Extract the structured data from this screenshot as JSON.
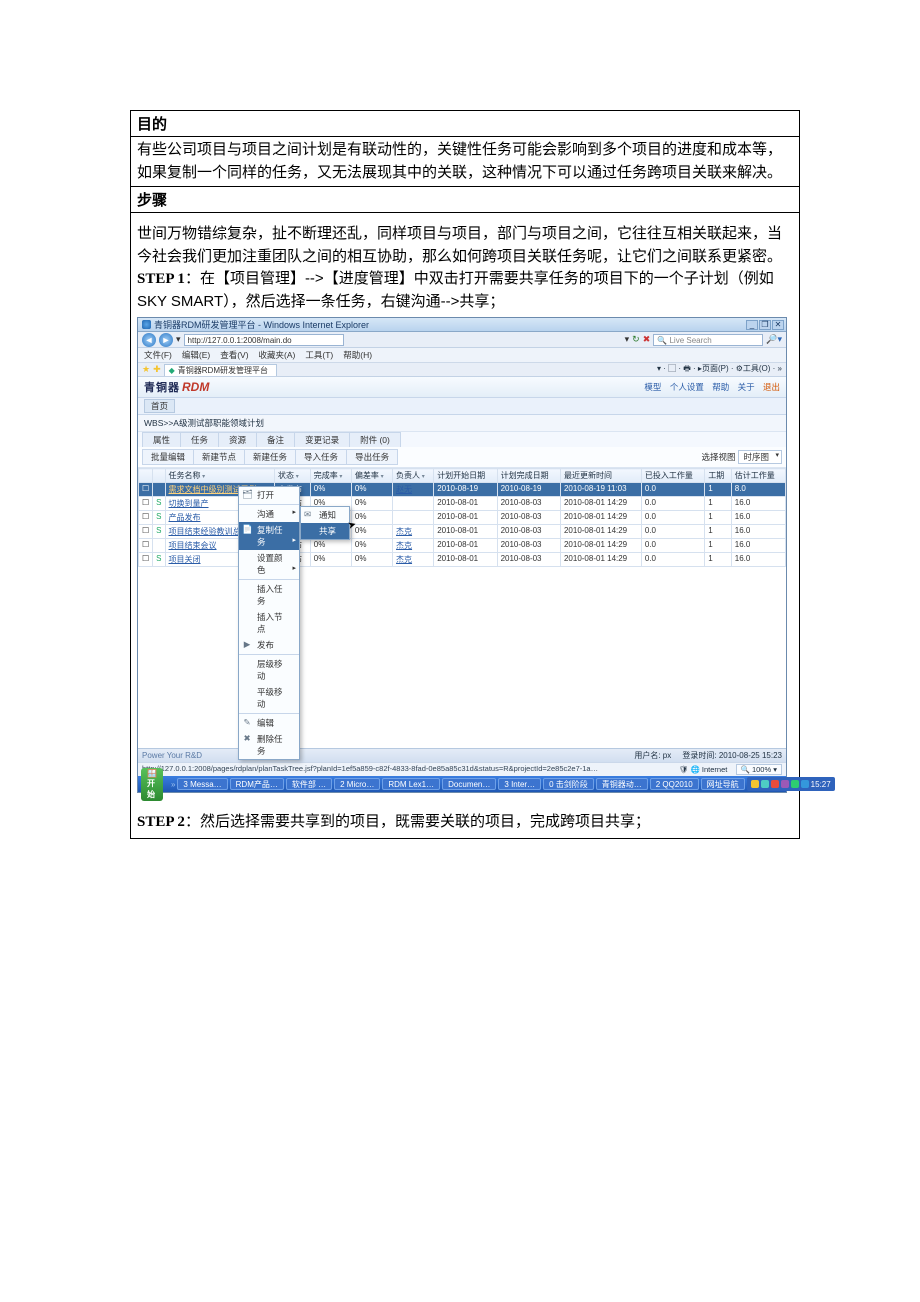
{
  "doc": {
    "heading_purpose": "目的",
    "purpose_text": "有些公司项目与项目之间计划是有联动性的，关键性任务可能会影响到多个项目的进度和成本等，如果复制一个同样的任务，又无法展现其中的关联，这种情况下可以通过任务跨项目关联来解决。",
    "heading_steps": "步骤",
    "intro_text": "世间万物错综复杂，扯不断理还乱，同样项目与项目，部门与项目之间，它往往互相关联起来，当今社会我们更加注重团队之间的相互协助，那么如何跨项目关联任务呢，让它们之间联系更紧密。",
    "step1_label": "STEP 1",
    "step1_text": "：在【项目管理】-->【进度管理】中双击打开需要共享任务的项目下的一个子计划（例如 SKY SMART），然后选择一条任务，右键沟通-->共享；",
    "step2_label": "STEP 2",
    "step2_text": "：然后选择需要共享到的项目，既需要关联的项目，完成跨项目共享；"
  },
  "ie": {
    "window_title": "青铜器RDM研发管理平台 - Windows Internet Explorer",
    "url": "http://127.0.0.1:2008/main.do",
    "search_placeholder": "Live Search",
    "menus": [
      "文件(F)",
      "编辑(E)",
      "查看(V)",
      "收藏夹(A)",
      "工具(T)",
      "帮助(H)"
    ],
    "tab_title": "青铜器RDM研发管理平台",
    "toolitems": "▾ · ▢ · 🖶 · ▸页面(P) · ⚙工具(O) · »"
  },
  "app": {
    "brand_cn": "青铜器",
    "brand_en": "RDM",
    "banner_links": {
      "model": "模型",
      "personal": "个人设置",
      "help": "帮助",
      "about": "关于",
      "logout": "退出"
    },
    "crumb": "首页",
    "plan_path": "WBS>>A级测试部职能领域计划",
    "tabs": [
      "属性",
      "任务",
      "资源",
      "备注",
      "变更记录",
      "附件 (0)"
    ],
    "toolbar": [
      "批量编辑",
      "新建节点",
      "新建任务",
      "导入任务",
      "导出任务"
    ],
    "view_label": "选择视图",
    "view_value": "时序图"
  },
  "grid": {
    "cols": [
      "",
      "",
      "任务名称",
      "状态",
      "完成率",
      "偏差率",
      "负责人",
      "计划开始日期",
      "计划完成日期",
      "最近更新时间",
      "已投入工作量",
      "工期",
      "估计工作量"
    ],
    "rows": [
      {
        "s": "",
        "name": "需求文档中级别测试用例",
        "status": "未发布",
        "pct": "0%",
        "dev": "0%",
        "owner": "赵无",
        "pstart": "2010-08-19",
        "pend": "2010-08-19",
        "upd": "2010-08-19 11:03",
        "inp": "0.0",
        "dur": "1",
        "est": "8.0",
        "sel": true
      },
      {
        "s": "S",
        "name": "切换到量产",
        "status": "未发布",
        "pct": "0%",
        "dev": "0%",
        "owner": "",
        "pstart": "2010-08-01",
        "pend": "2010-08-03",
        "upd": "2010-08-01 14:29",
        "inp": "0.0",
        "dur": "1",
        "est": "16.0"
      },
      {
        "s": "S",
        "name": "产品发布",
        "status": "未发布",
        "pct": "0%",
        "dev": "0%",
        "owner": "",
        "pstart": "2010-08-01",
        "pend": "2010-08-03",
        "upd": "2010-08-01 14:29",
        "inp": "0.0",
        "dur": "1",
        "est": "16.0"
      },
      {
        "s": "S",
        "name": "项目结束经验教训总结",
        "status": "未发布",
        "pct": "0%",
        "dev": "0%",
        "owner": "杰克",
        "pstart": "2010-08-01",
        "pend": "2010-08-03",
        "upd": "2010-08-01 14:29",
        "inp": "0.0",
        "dur": "1",
        "est": "16.0"
      },
      {
        "s": "",
        "name": "项目结束会议",
        "status": "未发布",
        "pct": "0%",
        "dev": "0%",
        "owner": "杰克",
        "pstart": "2010-08-01",
        "pend": "2010-08-03",
        "upd": "2010-08-01 14:29",
        "inp": "0.0",
        "dur": "1",
        "est": "16.0"
      },
      {
        "s": "S",
        "name": "项目关闭",
        "status": "未发布",
        "pct": "0%",
        "dev": "0%",
        "owner": "杰克",
        "pstart": "2010-08-01",
        "pend": "2010-08-03",
        "upd": "2010-08-01 14:29",
        "inp": "0.0",
        "dur": "1",
        "est": "16.0"
      }
    ]
  },
  "ctx": {
    "items": [
      {
        "label": "打开",
        "icon": "🗂"
      },
      {
        "label": "沟通",
        "arrow": true
      },
      {
        "label": "复制任务",
        "icon": "📄",
        "hover": true,
        "arrow": true
      },
      {
        "label": "设置颜色",
        "arrow": true
      },
      {
        "label": "插入任务"
      },
      {
        "label": "插入节点"
      },
      {
        "label": "发布",
        "icon": "▶"
      },
      {
        "label": "层级移动"
      },
      {
        "label": "平级移动"
      },
      {
        "label": "编辑",
        "icon": "✎"
      },
      {
        "label": "删除任务",
        "icon": "✖"
      }
    ],
    "sub": [
      {
        "label": "通知",
        "icon": "✉"
      },
      {
        "label": "共享",
        "hover": true
      }
    ]
  },
  "footer": {
    "brand": "Power Your R&D",
    "user_label": "用户名: px",
    "login_time": "登录时间: 2010-08-25 15:23",
    "status_url": "http://127.0.0.1:2008/pages/rdplan/planTaskTree.jsf?planId=1ef5a859-c82f-4833-8fad-0e85a85c31d&status=R&projectId=2e85c2e7-1a…",
    "internet": "Internet",
    "zoom": "100%"
  },
  "taskbar": {
    "start": "开始",
    "items": [
      "3 Messa…",
      "RDM产品…",
      "软件部 …",
      "2 Micro…",
      "RDM Lex1…",
      "Documen…",
      "3 Inter…",
      "0 击剑阶段",
      "青铜器动…",
      "2 QQ2010",
      "网址导航"
    ],
    "clock": "15:27"
  }
}
